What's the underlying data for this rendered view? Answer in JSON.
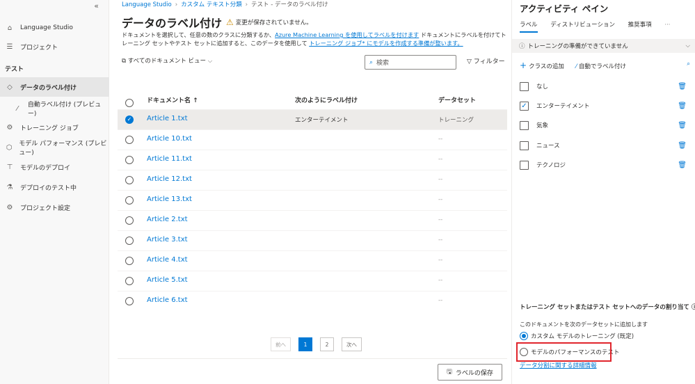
{
  "sidebar": {
    "collapse_glyph": "«",
    "items": [
      {
        "label": "Language Studio",
        "icon": "home-icon"
      },
      {
        "label": "プロジェクト",
        "icon": "list-icon"
      }
    ],
    "section": "テスト",
    "section_items": [
      {
        "label": "データのラベル付け",
        "icon": "tag-icon",
        "active": true
      },
      {
        "label": "自動ラベル付け (プレビュー)",
        "icon": "wand-icon"
      },
      {
        "label": "トレーニング ジョブ",
        "icon": "training-icon"
      },
      {
        "label": "モデル パフォーマンス (プレビュー)",
        "icon": "model-icon"
      },
      {
        "label": "モデルのデプロイ",
        "icon": "deploy-icon"
      },
      {
        "label": "デプロイのテスト中",
        "icon": "flask-icon"
      },
      {
        "label": "プロジェクト設定",
        "icon": "gear-icon"
      }
    ]
  },
  "breadcrumb": [
    "Language Studio",
    "カスタム テキスト分類",
    "テスト - データのラベル付け"
  ],
  "page": {
    "title": "データのラベル付け",
    "unsaved": "変更が保存されていません。",
    "desc_1": "ドキュメントを選択して、任意の数のクラスに分類するか、",
    "desc_link_1": "Azure Machine Learning を使用してラベルを付けます",
    "desc_2": " ドキュメントにラベルを付けてトレーニング セットやテスト セットに追加すると、このデータを使用して ",
    "desc_link_2": "トレーニング ジョブ* にモデルを作成する準備が整います。",
    "view_filter": "すべてのドキュメント ビュー",
    "search_placeholder": "検索",
    "filter_label": "フィルター"
  },
  "table": {
    "columns": [
      "ドキュメント名 ↑",
      "次のようにラベル付け",
      "データセット"
    ],
    "rows": [
      {
        "name": "Article 1.txt",
        "label": "エンターテイメント",
        "dataset": "トレーニング",
        "selected": true
      },
      {
        "name": "Article 10.txt",
        "label": "",
        "dataset": "--"
      },
      {
        "name": "Article 11.txt",
        "label": "",
        "dataset": "--"
      },
      {
        "name": "Article 12.txt",
        "label": "",
        "dataset": "--"
      },
      {
        "name": "Article 13.txt",
        "label": "",
        "dataset": "--"
      },
      {
        "name": "Article 2.txt",
        "label": "",
        "dataset": "--"
      },
      {
        "name": "Article 3.txt",
        "label": "",
        "dataset": "--"
      },
      {
        "name": "Article 4.txt",
        "label": "",
        "dataset": "--"
      },
      {
        "name": "Article 5.txt",
        "label": "",
        "dataset": "--"
      },
      {
        "name": "Article 6.txt",
        "label": "",
        "dataset": "--"
      }
    ]
  },
  "pager": {
    "prev": "前へ",
    "pages": [
      "1",
      "2"
    ],
    "next": "次へ"
  },
  "save_label": "ラベルの保存",
  "pane": {
    "title": "アクティビティ ペイン",
    "tabs": [
      "ラベル",
      "ディストリビューション",
      "推奨事項",
      "···"
    ],
    "notice": "トレーニングの準備ができていません",
    "add_class": "クラスの追加",
    "auto_label": "自動でラベル付け",
    "labels": [
      {
        "name": "なし",
        "checked": false
      },
      {
        "name": "エンターテイメント",
        "checked": true
      },
      {
        "name": "気象",
        "checked": false
      },
      {
        "name": "ニュース",
        "checked": false
      },
      {
        "name": "テクノロジ",
        "checked": false
      }
    ],
    "split_title": "トレーニング セットまたはテスト セットへのデータの割り当て ⓘ",
    "split_sub": "このドキュメントを次のデータセットに追加します",
    "opt_train": "カスタム モデルのトレーニング (既定)",
    "opt_test": "モデルのパフォーマンスのテスト",
    "more_link": "データ分割に関する詳細情報"
  },
  "colors": {
    "accent": "#0078d4",
    "highlight": "#e0252c",
    "warning": "#ca8a00"
  }
}
